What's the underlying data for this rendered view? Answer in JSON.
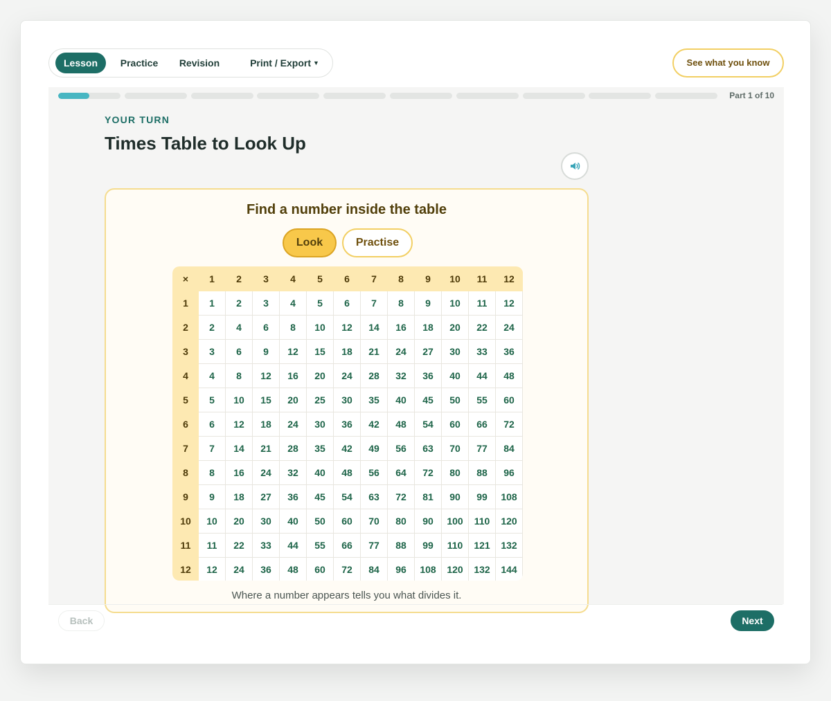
{
  "nav": {
    "tabs": [
      {
        "label": "Lesson",
        "active": true
      },
      {
        "label": "Practice",
        "active": false
      },
      {
        "label": "Revision",
        "active": false
      },
      {
        "label": "Print / Export",
        "active": false,
        "has_caret": true
      }
    ]
  },
  "header": {
    "assess_button": "See what you know"
  },
  "progress": {
    "segments_total": 10,
    "current_segment": 1,
    "current_segment_fill": 0.5,
    "label": "Part 1 of 10"
  },
  "lesson": {
    "eyebrow": "YOUR TURN",
    "title": "Times Table to Look Up",
    "audio_icon": "speaker-icon"
  },
  "panel": {
    "heading": "Find a number inside the table",
    "toggle": {
      "look": "Look",
      "practise": "Practise",
      "selected": "Look"
    },
    "note": "Where a number appears tells you what divides it."
  },
  "table": {
    "corner": "×",
    "columns": [
      "1",
      "2",
      "3",
      "4",
      "5",
      "6",
      "7",
      "8",
      "9",
      "10",
      "11",
      "12"
    ],
    "rows": [
      {
        "label": "1",
        "cells": [
          "1",
          "2",
          "3",
          "4",
          "5",
          "6",
          "7",
          "8",
          "9",
          "10",
          "11",
          "12"
        ]
      },
      {
        "label": "2",
        "cells": [
          "2",
          "4",
          "6",
          "8",
          "10",
          "12",
          "14",
          "16",
          "18",
          "20",
          "22",
          "24"
        ]
      },
      {
        "label": "3",
        "cells": [
          "3",
          "6",
          "9",
          "12",
          "15",
          "18",
          "21",
          "24",
          "27",
          "30",
          "33",
          "36"
        ]
      },
      {
        "label": "4",
        "cells": [
          "4",
          "8",
          "12",
          "16",
          "20",
          "24",
          "28",
          "32",
          "36",
          "40",
          "44",
          "48"
        ]
      },
      {
        "label": "5",
        "cells": [
          "5",
          "10",
          "15",
          "20",
          "25",
          "30",
          "35",
          "40",
          "45",
          "50",
          "55",
          "60"
        ]
      },
      {
        "label": "6",
        "cells": [
          "6",
          "12",
          "18",
          "24",
          "30",
          "36",
          "42",
          "48",
          "54",
          "60",
          "66",
          "72"
        ]
      },
      {
        "label": "7",
        "cells": [
          "7",
          "14",
          "21",
          "28",
          "35",
          "42",
          "49",
          "56",
          "63",
          "70",
          "77",
          "84"
        ]
      },
      {
        "label": "8",
        "cells": [
          "8",
          "16",
          "24",
          "32",
          "40",
          "48",
          "56",
          "64",
          "72",
          "80",
          "88",
          "96"
        ]
      },
      {
        "label": "9",
        "cells": [
          "9",
          "18",
          "27",
          "36",
          "45",
          "54",
          "63",
          "72",
          "81",
          "90",
          "99",
          "108"
        ]
      },
      {
        "label": "10",
        "cells": [
          "10",
          "20",
          "30",
          "40",
          "50",
          "60",
          "70",
          "80",
          "90",
          "100",
          "110",
          "120"
        ]
      },
      {
        "label": "11",
        "cells": [
          "11",
          "22",
          "33",
          "44",
          "55",
          "66",
          "77",
          "88",
          "99",
          "110",
          "121",
          "132"
        ]
      },
      {
        "label": "12",
        "cells": [
          "12",
          "24",
          "36",
          "48",
          "60",
          "72",
          "84",
          "96",
          "108",
          "120",
          "132",
          "144"
        ]
      }
    ]
  },
  "footer": {
    "back": "Back",
    "next": "Next",
    "back_enabled": false
  },
  "colors": {
    "brand": "#1d6e66",
    "progress_active": "#47b6c2",
    "accent_yellow": "#f8c84a",
    "cell_text": "#1d6448"
  }
}
